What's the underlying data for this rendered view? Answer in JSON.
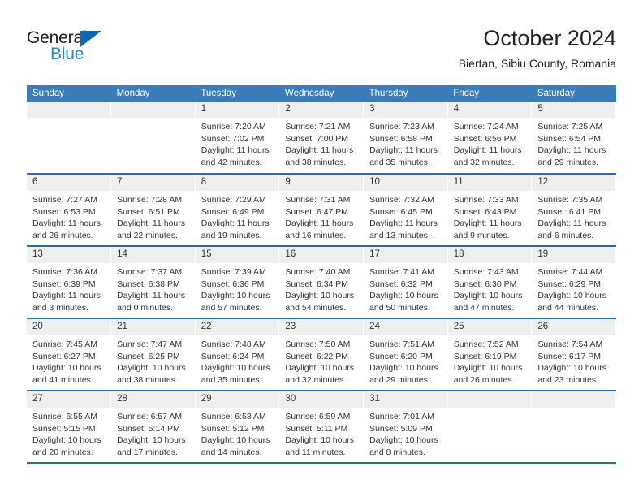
{
  "brand": {
    "name_top": "General",
    "name_bottom": "Blue",
    "triangle_color": "#1267b2",
    "blue_color": "#2389d4",
    "dark_color": "#231f20"
  },
  "header": {
    "title": "October 2024",
    "subtitle": "Biertan, Sibiu County, Romania"
  },
  "theme": {
    "header_blue": "#3b7cbd",
    "row_border_blue": "#2b6cad",
    "daynum_band": "#efefef",
    "text": "#333333"
  },
  "weekday_headers": [
    "Sunday",
    "Monday",
    "Tuesday",
    "Wednesday",
    "Thursday",
    "Friday",
    "Saturday"
  ],
  "labels": {
    "sunrise_prefix": "Sunrise:",
    "sunset_prefix": "Sunset:",
    "daylight_prefix": "Daylight:"
  },
  "weeks": [
    [
      {
        "day": "",
        "lines": []
      },
      {
        "day": "",
        "lines": []
      },
      {
        "day": "1",
        "lines": [
          "Sunrise: 7:20 AM",
          "Sunset: 7:02 PM",
          "Daylight: 11 hours",
          "and 42 minutes."
        ]
      },
      {
        "day": "2",
        "lines": [
          "Sunrise: 7:21 AM",
          "Sunset: 7:00 PM",
          "Daylight: 11 hours",
          "and 38 minutes."
        ]
      },
      {
        "day": "3",
        "lines": [
          "Sunrise: 7:23 AM",
          "Sunset: 6:58 PM",
          "Daylight: 11 hours",
          "and 35 minutes."
        ]
      },
      {
        "day": "4",
        "lines": [
          "Sunrise: 7:24 AM",
          "Sunset: 6:56 PM",
          "Daylight: 11 hours",
          "and 32 minutes."
        ]
      },
      {
        "day": "5",
        "lines": [
          "Sunrise: 7:25 AM",
          "Sunset: 6:54 PM",
          "Daylight: 11 hours",
          "and 29 minutes."
        ]
      }
    ],
    [
      {
        "day": "6",
        "lines": [
          "Sunrise: 7:27 AM",
          "Sunset: 6:53 PM",
          "Daylight: 11 hours",
          "and 26 minutes."
        ]
      },
      {
        "day": "7",
        "lines": [
          "Sunrise: 7:28 AM",
          "Sunset: 6:51 PM",
          "Daylight: 11 hours",
          "and 22 minutes."
        ]
      },
      {
        "day": "8",
        "lines": [
          "Sunrise: 7:29 AM",
          "Sunset: 6:49 PM",
          "Daylight: 11 hours",
          "and 19 minutes."
        ]
      },
      {
        "day": "9",
        "lines": [
          "Sunrise: 7:31 AM",
          "Sunset: 6:47 PM",
          "Daylight: 11 hours",
          "and 16 minutes."
        ]
      },
      {
        "day": "10",
        "lines": [
          "Sunrise: 7:32 AM",
          "Sunset: 6:45 PM",
          "Daylight: 11 hours",
          "and 13 minutes."
        ]
      },
      {
        "day": "11",
        "lines": [
          "Sunrise: 7:33 AM",
          "Sunset: 6:43 PM",
          "Daylight: 11 hours",
          "and 9 minutes."
        ]
      },
      {
        "day": "12",
        "lines": [
          "Sunrise: 7:35 AM",
          "Sunset: 6:41 PM",
          "Daylight: 11 hours",
          "and 6 minutes."
        ]
      }
    ],
    [
      {
        "day": "13",
        "lines": [
          "Sunrise: 7:36 AM",
          "Sunset: 6:39 PM",
          "Daylight: 11 hours",
          "and 3 minutes."
        ]
      },
      {
        "day": "14",
        "lines": [
          "Sunrise: 7:37 AM",
          "Sunset: 6:38 PM",
          "Daylight: 11 hours",
          "and 0 minutes."
        ]
      },
      {
        "day": "15",
        "lines": [
          "Sunrise: 7:39 AM",
          "Sunset: 6:36 PM",
          "Daylight: 10 hours",
          "and 57 minutes."
        ]
      },
      {
        "day": "16",
        "lines": [
          "Sunrise: 7:40 AM",
          "Sunset: 6:34 PM",
          "Daylight: 10 hours",
          "and 54 minutes."
        ]
      },
      {
        "day": "17",
        "lines": [
          "Sunrise: 7:41 AM",
          "Sunset: 6:32 PM",
          "Daylight: 10 hours",
          "and 50 minutes."
        ]
      },
      {
        "day": "18",
        "lines": [
          "Sunrise: 7:43 AM",
          "Sunset: 6:30 PM",
          "Daylight: 10 hours",
          "and 47 minutes."
        ]
      },
      {
        "day": "19",
        "lines": [
          "Sunrise: 7:44 AM",
          "Sunset: 6:29 PM",
          "Daylight: 10 hours",
          "and 44 minutes."
        ]
      }
    ],
    [
      {
        "day": "20",
        "lines": [
          "Sunrise: 7:45 AM",
          "Sunset: 6:27 PM",
          "Daylight: 10 hours",
          "and 41 minutes."
        ]
      },
      {
        "day": "21",
        "lines": [
          "Sunrise: 7:47 AM",
          "Sunset: 6:25 PM",
          "Daylight: 10 hours",
          "and 38 minutes."
        ]
      },
      {
        "day": "22",
        "lines": [
          "Sunrise: 7:48 AM",
          "Sunset: 6:24 PM",
          "Daylight: 10 hours",
          "and 35 minutes."
        ]
      },
      {
        "day": "23",
        "lines": [
          "Sunrise: 7:50 AM",
          "Sunset: 6:22 PM",
          "Daylight: 10 hours",
          "and 32 minutes."
        ]
      },
      {
        "day": "24",
        "lines": [
          "Sunrise: 7:51 AM",
          "Sunset: 6:20 PM",
          "Daylight: 10 hours",
          "and 29 minutes."
        ]
      },
      {
        "day": "25",
        "lines": [
          "Sunrise: 7:52 AM",
          "Sunset: 6:19 PM",
          "Daylight: 10 hours",
          "and 26 minutes."
        ]
      },
      {
        "day": "26",
        "lines": [
          "Sunrise: 7:54 AM",
          "Sunset: 6:17 PM",
          "Daylight: 10 hours",
          "and 23 minutes."
        ]
      }
    ],
    [
      {
        "day": "27",
        "lines": [
          "Sunrise: 6:55 AM",
          "Sunset: 5:15 PM",
          "Daylight: 10 hours",
          "and 20 minutes."
        ]
      },
      {
        "day": "28",
        "lines": [
          "Sunrise: 6:57 AM",
          "Sunset: 5:14 PM",
          "Daylight: 10 hours",
          "and 17 minutes."
        ]
      },
      {
        "day": "29",
        "lines": [
          "Sunrise: 6:58 AM",
          "Sunset: 5:12 PM",
          "Daylight: 10 hours",
          "and 14 minutes."
        ]
      },
      {
        "day": "30",
        "lines": [
          "Sunrise: 6:59 AM",
          "Sunset: 5:11 PM",
          "Daylight: 10 hours",
          "and 11 minutes."
        ]
      },
      {
        "day": "31",
        "lines": [
          "Sunrise: 7:01 AM",
          "Sunset: 5:09 PM",
          "Daylight: 10 hours",
          "and 8 minutes."
        ]
      },
      {
        "day": "",
        "lines": []
      },
      {
        "day": "",
        "lines": []
      }
    ]
  ]
}
